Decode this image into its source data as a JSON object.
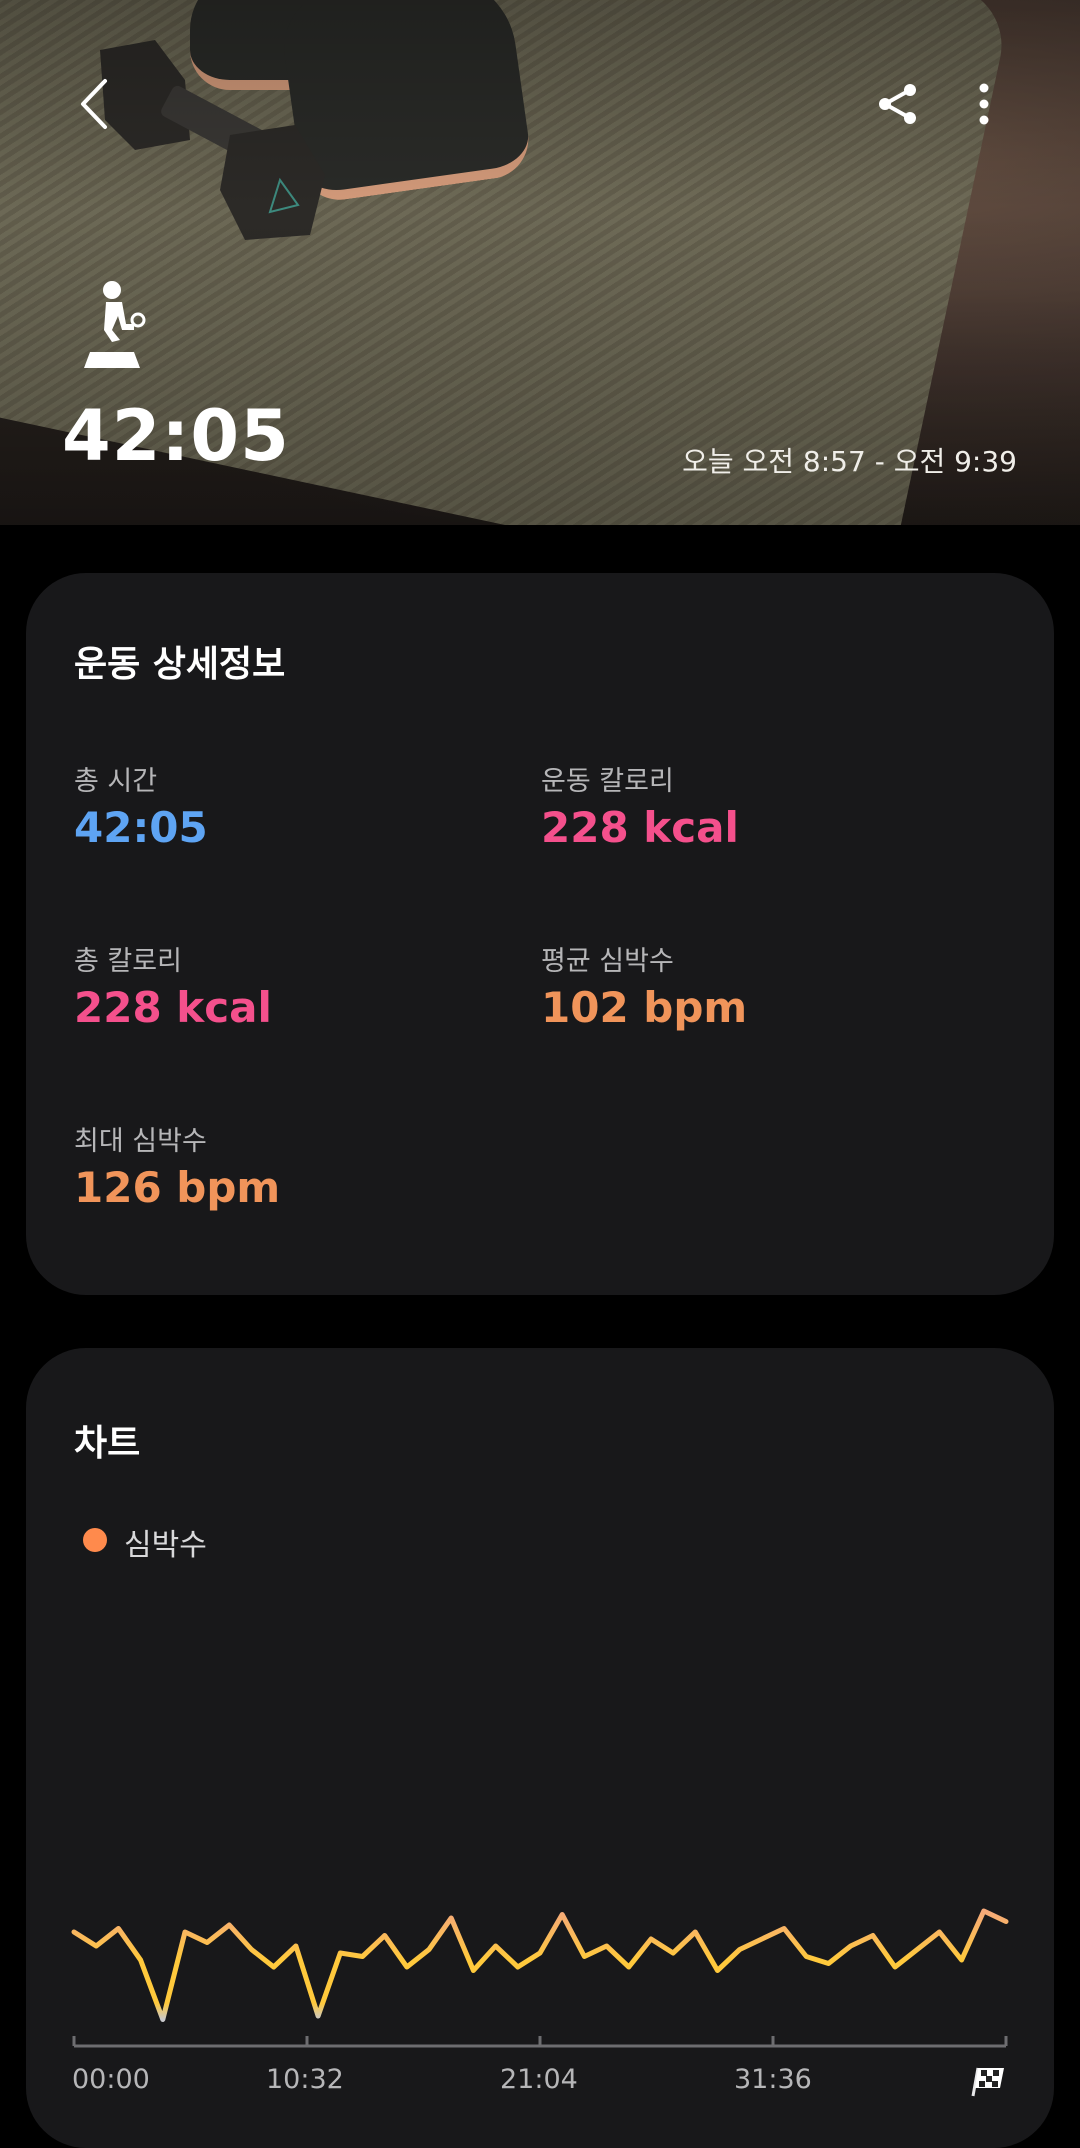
{
  "header": {
    "duration": "42:05",
    "time_range": "오늘 오전 8:57 - 오전 9:39",
    "back_icon": "chevron-left-icon",
    "share_icon": "share-icon",
    "more_icon": "more-vertical-icon",
    "workout_icon": "weight-training-icon"
  },
  "details": {
    "title": "운동 상세정보",
    "stats": [
      {
        "label": "총 시간",
        "value": "42:05",
        "color": "#5ea4f3"
      },
      {
        "label": "운동 칼로리",
        "value": "228 kcal",
        "color": "#f4508c"
      },
      {
        "label": "총 칼로리",
        "value": "228 kcal",
        "color": "#f4508c"
      },
      {
        "label": "평균 심박수",
        "value": "102 bpm",
        "color": "#f0945a"
      },
      {
        "label": "최대 심박수",
        "value": "126 bpm",
        "color": "#f0945a"
      }
    ]
  },
  "chart": {
    "title": "차트",
    "legend": "심박수",
    "finish_icon": "checkered-flag-icon"
  },
  "chart_data": {
    "type": "line",
    "title": "",
    "xlabel": "",
    "ylabel": "",
    "x_tick_labels": [
      "00:00",
      "10:32",
      "21:04",
      "31:36"
    ],
    "series": [
      {
        "name": "심박수",
        "x": [
          "00:00",
          "01:00",
          "02:00",
          "03:00",
          "04:00",
          "05:00",
          "06:00",
          "07:00",
          "08:00",
          "09:00",
          "10:00",
          "11:00",
          "12:00",
          "13:00",
          "14:00",
          "15:00",
          "16:00",
          "17:00",
          "18:00",
          "19:00",
          "20:00",
          "21:00",
          "22:00",
          "23:00",
          "24:00",
          "25:00",
          "26:00",
          "27:00",
          "28:00",
          "29:00",
          "30:00",
          "31:00",
          "32:00",
          "33:00",
          "34:00",
          "35:00",
          "36:00",
          "37:00",
          "38:00",
          "39:00",
          "40:00",
          "41:00",
          "42:00"
        ],
        "values": [
          108,
          104,
          109,
          100,
          83,
          108,
          105,
          110,
          103,
          98,
          104,
          84,
          102,
          101,
          107,
          98,
          103,
          112,
          97,
          104,
          98,
          102,
          113,
          101,
          104,
          98,
          106,
          102,
          108,
          97,
          103,
          106,
          109,
          101,
          99,
          104,
          107,
          98,
          103,
          108,
          100,
          114,
          111
        ]
      }
    ],
    "colors": [
      "#ffc93c",
      "#f5a97a",
      "#c9c9cb"
    ],
    "grid": false,
    "legend_position": "top-left"
  }
}
